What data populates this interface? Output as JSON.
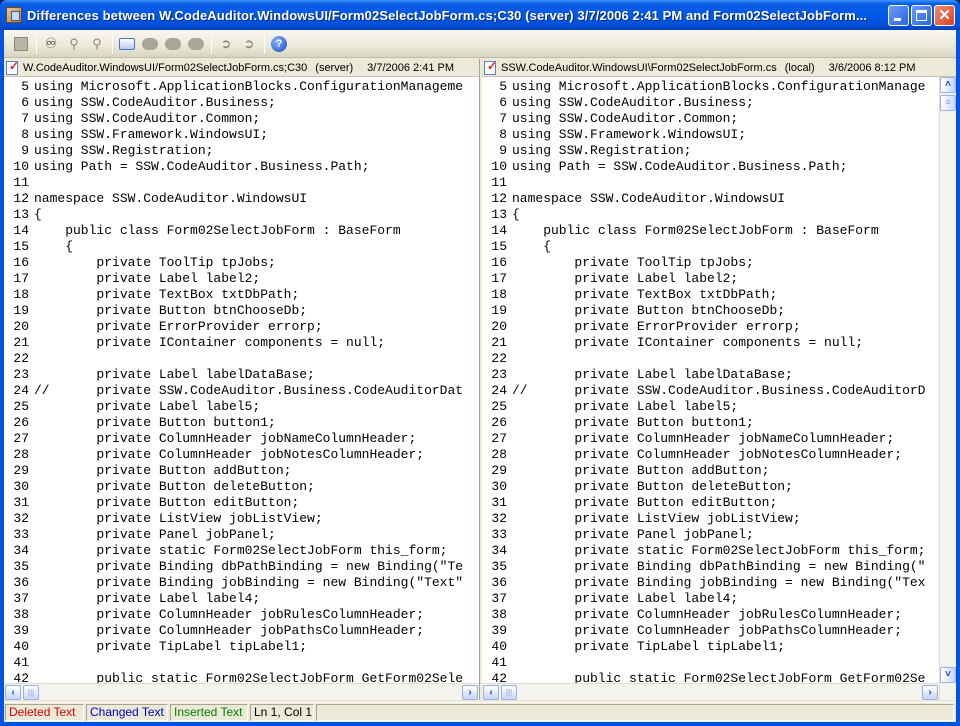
{
  "window": {
    "title": "Differences between W.CodeAuditor.WindowsUI/Form02SelectJobForm.cs;C30  (server)    3/7/2006 2:41 PM and Form02SelectJobForm...",
    "controls": {
      "minimize": "minimize",
      "maximize": "maximize",
      "close": "close"
    }
  },
  "toolbar": {
    "buttons": [
      {
        "name": "copy-file-button",
        "icon": "doc-icon",
        "enabled": false
      },
      {
        "name": "find-button",
        "icon": "binoculars-icon",
        "enabled": true
      },
      {
        "name": "find-next-button",
        "icon": "find-next-icon",
        "enabled": false
      },
      {
        "name": "find-previous-button",
        "icon": "find-previous-icon",
        "enabled": false
      },
      {
        "name": "view-options-button",
        "icon": "rectangle-icon",
        "enabled": true
      },
      {
        "name": "first-difference-button",
        "icon": "speech-bubble-icon",
        "enabled": false
      },
      {
        "name": "previous-difference-button",
        "icon": "speech-bubble-icon",
        "enabled": false
      },
      {
        "name": "next-difference-button",
        "icon": "speech-bubble-icon",
        "enabled": false
      },
      {
        "name": "go-back-button",
        "icon": "arrow-left-icon",
        "enabled": false
      },
      {
        "name": "go-forward-button",
        "icon": "arrow-right-icon",
        "enabled": false
      },
      {
        "name": "help-button",
        "icon": "help-icon",
        "enabled": true
      }
    ]
  },
  "left_pane": {
    "file": "W.CodeAuditor.WindowsUI/Form02SelectJobForm.cs;C30",
    "location": "(server)",
    "timestamp": "3/7/2006 2:41 PM",
    "lines": [
      {
        "n": "5",
        "text": "using Microsoft.ApplicationBlocks.ConfigurationManageme"
      },
      {
        "n": "6",
        "text": "using SSW.CodeAuditor.Business;"
      },
      {
        "n": "7",
        "text": "using SSW.CodeAuditor.Common;"
      },
      {
        "n": "8",
        "text": "using SSW.Framework.WindowsUI;"
      },
      {
        "n": "9",
        "text": "using SSW.Registration;"
      },
      {
        "n": "10",
        "text": "using Path = SSW.CodeAuditor.Business.Path;"
      },
      {
        "n": "11",
        "text": ""
      },
      {
        "n": "12",
        "text": "namespace SSW.CodeAuditor.WindowsUI"
      },
      {
        "n": "13",
        "text": "{"
      },
      {
        "n": "14",
        "text": "    public class Form02SelectJobForm : BaseForm"
      },
      {
        "n": "15",
        "text": "    {"
      },
      {
        "n": "16",
        "text": "        private ToolTip tpJobs;"
      },
      {
        "n": "17",
        "text": "        private Label label2;"
      },
      {
        "n": "18",
        "text": "        private TextBox txtDbPath;"
      },
      {
        "n": "19",
        "text": "        private Button btnChooseDb;"
      },
      {
        "n": "20",
        "text": "        private ErrorProvider errorp;"
      },
      {
        "n": "21",
        "text": "        private IContainer components = null;"
      },
      {
        "n": "22",
        "text": ""
      },
      {
        "n": "23",
        "text": "        private Label labelDataBase;"
      },
      {
        "n": "24",
        "text": "//      private SSW.CodeAuditor.Business.CodeAuditorDat"
      },
      {
        "n": "25",
        "text": "        private Label label5;"
      },
      {
        "n": "26",
        "text": "        private Button button1;"
      },
      {
        "n": "27",
        "text": "        private ColumnHeader jobNameColumnHeader;"
      },
      {
        "n": "28",
        "text": "        private ColumnHeader jobNotesColumnHeader;"
      },
      {
        "n": "29",
        "text": "        private Button addButton;"
      },
      {
        "n": "30",
        "text": "        private Button deleteButton;"
      },
      {
        "n": "31",
        "text": "        private Button editButton;"
      },
      {
        "n": "32",
        "text": "        private ListView jobListView;"
      },
      {
        "n": "33",
        "text": "        private Panel jobPanel;"
      },
      {
        "n": "34",
        "text": "        private static Form02SelectJobForm this_form;"
      },
      {
        "n": "35",
        "text": "        private Binding dbPathBinding = new Binding(\"Te"
      },
      {
        "n": "36",
        "text": "        private Binding jobBinding = new Binding(\"Text\""
      },
      {
        "n": "37",
        "text": "        private Label label4;"
      },
      {
        "n": "38",
        "text": "        private ColumnHeader jobRulesColumnHeader;"
      },
      {
        "n": "39",
        "text": "        private ColumnHeader jobPathsColumnHeader;"
      },
      {
        "n": "40",
        "text": "        private TipLabel tipLabel1;"
      },
      {
        "n": "41",
        "text": ""
      },
      {
        "n": "42",
        "text": "        public static Form02SelectJobForm GetForm02Sele"
      }
    ]
  },
  "right_pane": {
    "file": "SSW.CodeAuditor.WindowsUI\\Form02SelectJobForm.cs",
    "location": "(local)",
    "timestamp": "3/6/2006 8:12 PM",
    "lines": [
      {
        "n": "5",
        "text": "using Microsoft.ApplicationBlocks.ConfigurationManage"
      },
      {
        "n": "6",
        "text": "using SSW.CodeAuditor.Business;"
      },
      {
        "n": "7",
        "text": "using SSW.CodeAuditor.Common;"
      },
      {
        "n": "8",
        "text": "using SSW.Framework.WindowsUI;"
      },
      {
        "n": "9",
        "text": "using SSW.Registration;"
      },
      {
        "n": "10",
        "text": "using Path = SSW.CodeAuditor.Business.Path;"
      },
      {
        "n": "11",
        "text": ""
      },
      {
        "n": "12",
        "text": "namespace SSW.CodeAuditor.WindowsUI"
      },
      {
        "n": "13",
        "text": "{"
      },
      {
        "n": "14",
        "text": "    public class Form02SelectJobForm : BaseForm"
      },
      {
        "n": "15",
        "text": "    {"
      },
      {
        "n": "16",
        "text": "        private ToolTip tpJobs;"
      },
      {
        "n": "17",
        "text": "        private Label label2;"
      },
      {
        "n": "18",
        "text": "        private TextBox txtDbPath;"
      },
      {
        "n": "19",
        "text": "        private Button btnChooseDb;"
      },
      {
        "n": "20",
        "text": "        private ErrorProvider errorp;"
      },
      {
        "n": "21",
        "text": "        private IContainer components = null;"
      },
      {
        "n": "22",
        "text": ""
      },
      {
        "n": "23",
        "text": "        private Label labelDataBase;"
      },
      {
        "n": "24",
        "text": "//      private SSW.CodeAuditor.Business.CodeAuditorD"
      },
      {
        "n": "25",
        "text": "        private Label label5;"
      },
      {
        "n": "26",
        "text": "        private Button button1;"
      },
      {
        "n": "27",
        "text": "        private ColumnHeader jobNameColumnHeader;"
      },
      {
        "n": "28",
        "text": "        private ColumnHeader jobNotesColumnHeader;"
      },
      {
        "n": "29",
        "text": "        private Button addButton;"
      },
      {
        "n": "30",
        "text": "        private Button deleteButton;"
      },
      {
        "n": "31",
        "text": "        private Button editButton;"
      },
      {
        "n": "32",
        "text": "        private ListView jobListView;"
      },
      {
        "n": "33",
        "text": "        private Panel jobPanel;"
      },
      {
        "n": "34",
        "text": "        private static Form02SelectJobForm this_form;"
      },
      {
        "n": "35",
        "text": "        private Binding dbPathBinding = new Binding(\""
      },
      {
        "n": "36",
        "text": "        private Binding jobBinding = new Binding(\"Tex"
      },
      {
        "n": "37",
        "text": "        private Label label4;"
      },
      {
        "n": "38",
        "text": "        private ColumnHeader jobRulesColumnHeader;"
      },
      {
        "n": "39",
        "text": "        private ColumnHeader jobPathsColumnHeader;"
      },
      {
        "n": "40",
        "text": "        private TipLabel tipLabel1;"
      },
      {
        "n": "41",
        "text": ""
      },
      {
        "n": "42",
        "text": "        public static Form02SelectJobForm GetForm02Se"
      }
    ]
  },
  "statusbar": {
    "deleted_label": "Deleted Text",
    "changed_label": "Changed Text",
    "inserted_label": "Inserted Text",
    "position": "Ln 1, Col 1",
    "colors": {
      "deleted": "#e00000",
      "changed": "#0000c0",
      "inserted": "#008000"
    }
  }
}
